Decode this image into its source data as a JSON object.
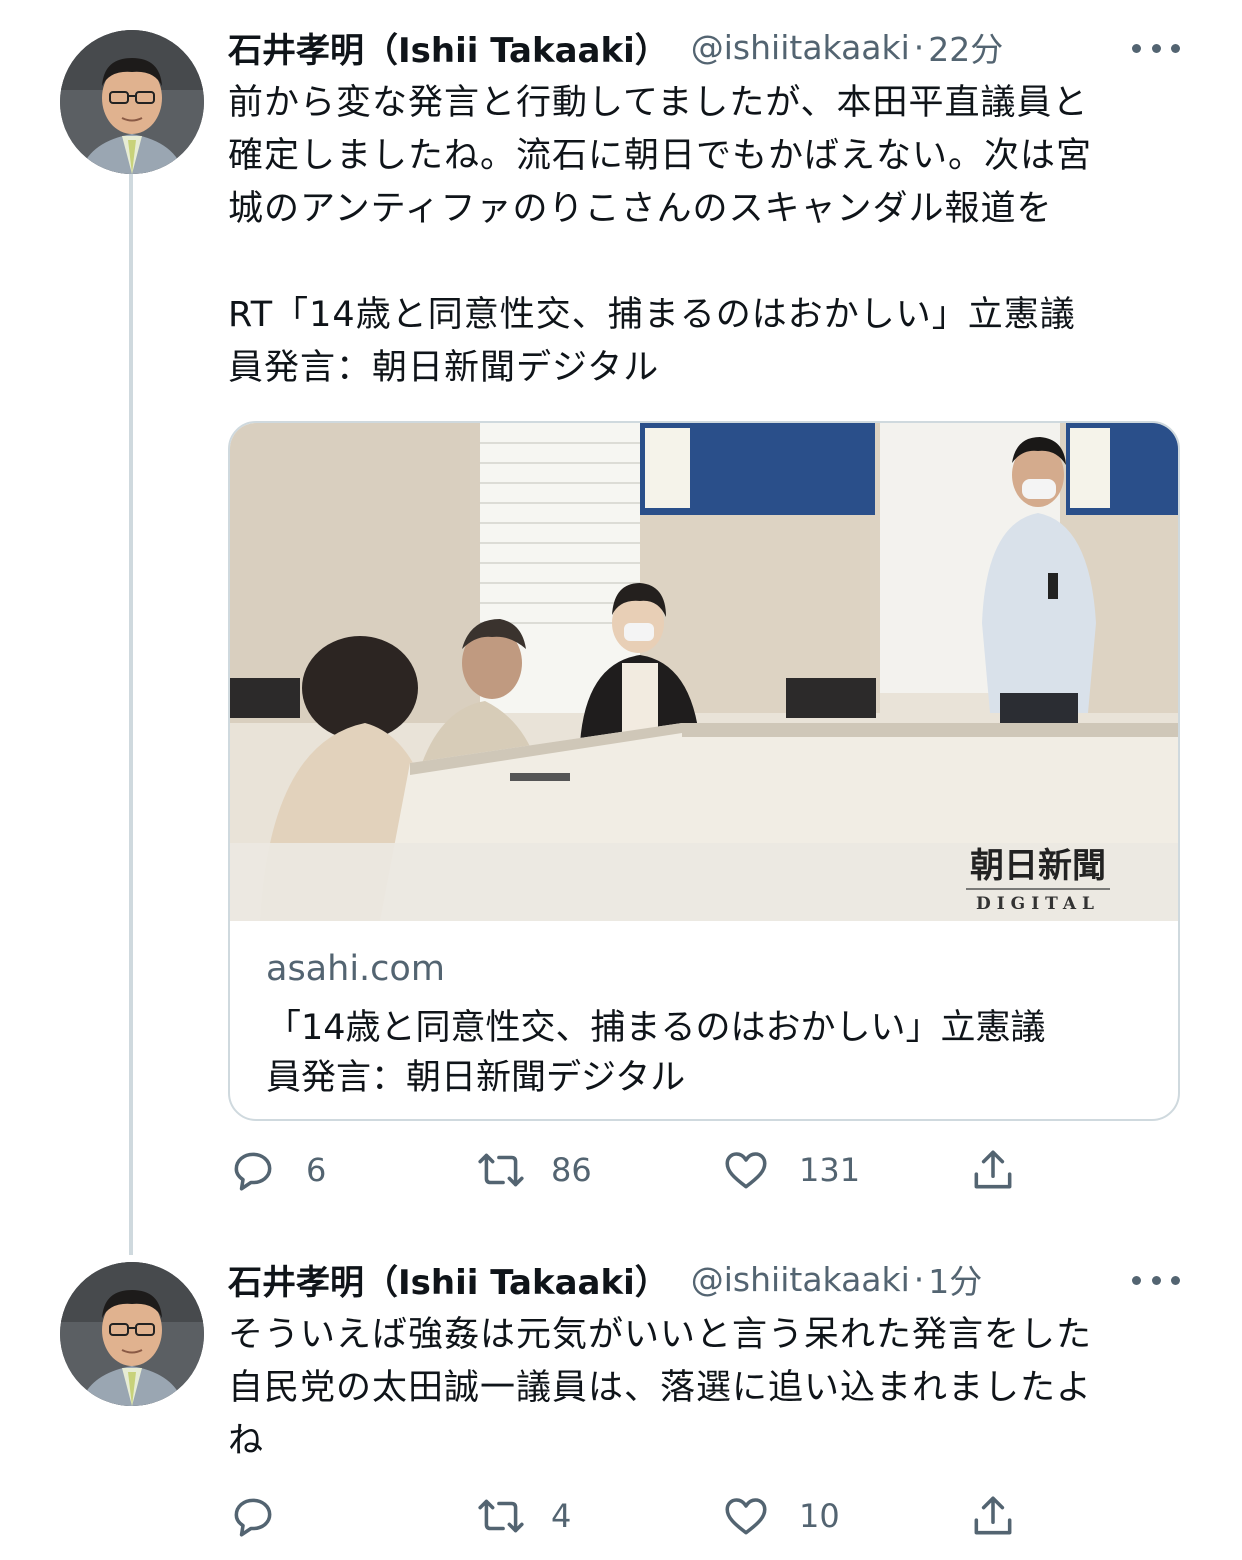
{
  "tweets": [
    {
      "author_name": "石井孝明（Ishii Takaaki）",
      "handle": "@ishiitakaaki",
      "separator": "·",
      "time": "22分",
      "text_lines": [
        "前から変な発言と行動してましたが、本田平直議員と",
        "確定しましたね。流石に朝日でもかばえない。次は宮",
        "城のアンティファのりこさんのスキャンダル報道を",
        "",
        "RT「14歳と同意性交、捕まるのはおかしい」立憲議",
        "員発言：朝日新聞デジタル"
      ],
      "card": {
        "domain": "asahi.com",
        "title_lines": [
          "「14歳と同意性交、捕まるのはおかしい」立憲議",
          "員発言：朝日新聞デジタル"
        ],
        "image_logo": "朝日新聞",
        "image_logo_sub": "DIGITAL"
      },
      "actions": {
        "reply_count": "6",
        "retweet_count": "86",
        "like_count": "131"
      },
      "icons": [
        "reply-icon",
        "retweet-icon",
        "like-icon",
        "share-icon",
        "more-icon"
      ]
    },
    {
      "author_name": "石井孝明（Ishii Takaaki）",
      "handle": "@ishiitakaaki",
      "separator": "·",
      "time": "1分",
      "text_lines": [
        "そういえば強姦は元気がいいと言う呆れた発言をした",
        "自民党の太田誠一議員は、落選に追い込まれましたよ",
        "ね"
      ],
      "actions": {
        "reply_count": "",
        "retweet_count": "4",
        "like_count": "10"
      },
      "icons": [
        "reply-icon",
        "retweet-icon",
        "like-icon",
        "share-icon",
        "more-icon"
      ]
    }
  ],
  "colors": {
    "text": "#0f1419",
    "secondary": "#536471",
    "border": "#cfd9de",
    "background": "#ffffff"
  }
}
